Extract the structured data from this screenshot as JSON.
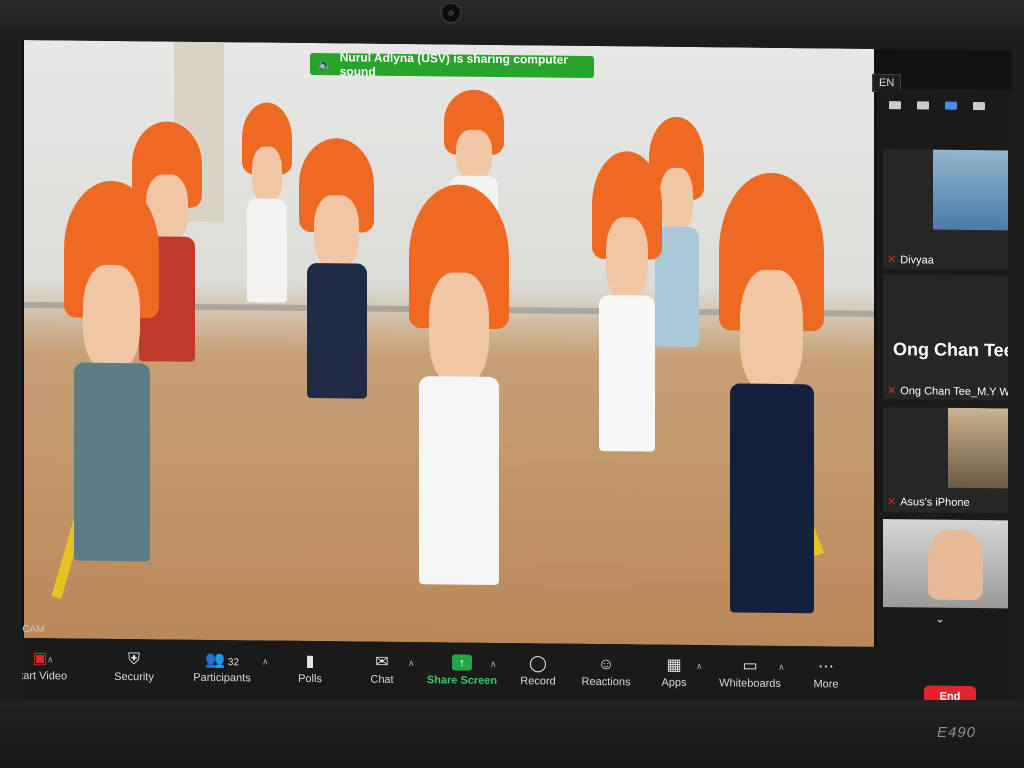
{
  "banner": {
    "text": "Nurul Adlyna (USV) is sharing computer sound"
  },
  "language": "EN",
  "participants_panel": {
    "tiles": [
      {
        "name": "Divyaa"
      },
      {
        "name": "Ong Chan Tee_M.Y World@U",
        "display_name": "Ong Chan Tee"
      },
      {
        "name": "Asus's iPhone"
      }
    ]
  },
  "toolbar": {
    "camera_label": "AIN_CAM",
    "start_video": "Start Video",
    "security": "Security",
    "participants": "Participants",
    "participants_count": "32",
    "polls": "Polls",
    "chat": "Chat",
    "share_screen": "Share Screen",
    "record": "Record",
    "reactions": "Reactions",
    "apps": "Apps",
    "whiteboards": "Whiteboards",
    "more": "More",
    "end": "End"
  },
  "laptop_model": "E490",
  "colors": {
    "share_green": "#23a54a",
    "end_red": "#e0252b",
    "banner_green": "#27a52a",
    "hat_orange": "#ee6a22"
  }
}
